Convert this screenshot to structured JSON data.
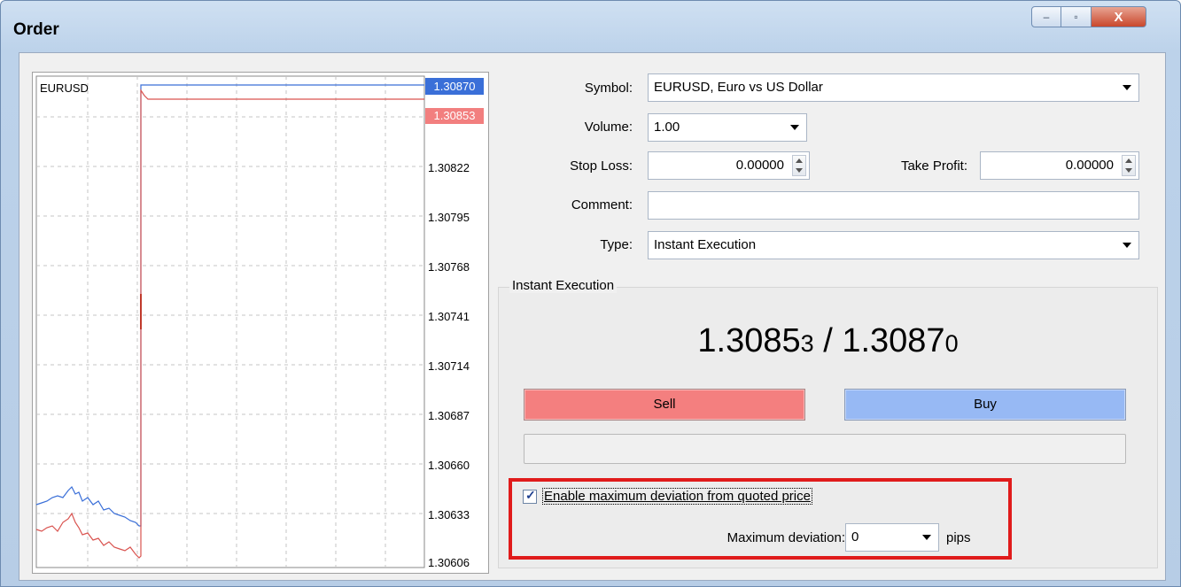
{
  "window": {
    "title": "Order",
    "controls": {
      "minimize": "–",
      "maximize": "▫",
      "close": "X"
    }
  },
  "chart": {
    "symbol": "EURUSD",
    "ask_label": "1.30870",
    "bid_label": "1.30853",
    "y_ticks": [
      "1.30822",
      "1.30795",
      "1.30768",
      "1.30741",
      "1.30714",
      "1.30687",
      "1.30660",
      "1.30633",
      "1.30606"
    ],
    "colors": {
      "ask": "#3a6fd8",
      "bid": "#d9534f",
      "grid": "#b8b8b8"
    }
  },
  "form": {
    "symbol": {
      "label": "Symbol:",
      "value": "EURUSD, Euro vs US Dollar"
    },
    "volume": {
      "label": "Volume:",
      "value": "1.00"
    },
    "stop_loss": {
      "label": "Stop Loss:",
      "value": "0.00000"
    },
    "take_profit": {
      "label": "Take Profit:",
      "value": "0.00000"
    },
    "comment": {
      "label": "Comment:",
      "value": ""
    },
    "type": {
      "label": "Type:",
      "value": "Instant Execution"
    }
  },
  "execution": {
    "group_title": "Instant Execution",
    "bid_main": "1.3085",
    "bid_small": "3",
    "separator": " / ",
    "ask_main": "1.3087",
    "ask_small": "0",
    "sell_label": "Sell",
    "buy_label": "Buy",
    "deviation_checkbox_label": "Enable maximum deviation from quoted price",
    "deviation_checked": true,
    "deviation_label": "Maximum deviation:",
    "deviation_value": "0",
    "deviation_unit": "pips"
  }
}
